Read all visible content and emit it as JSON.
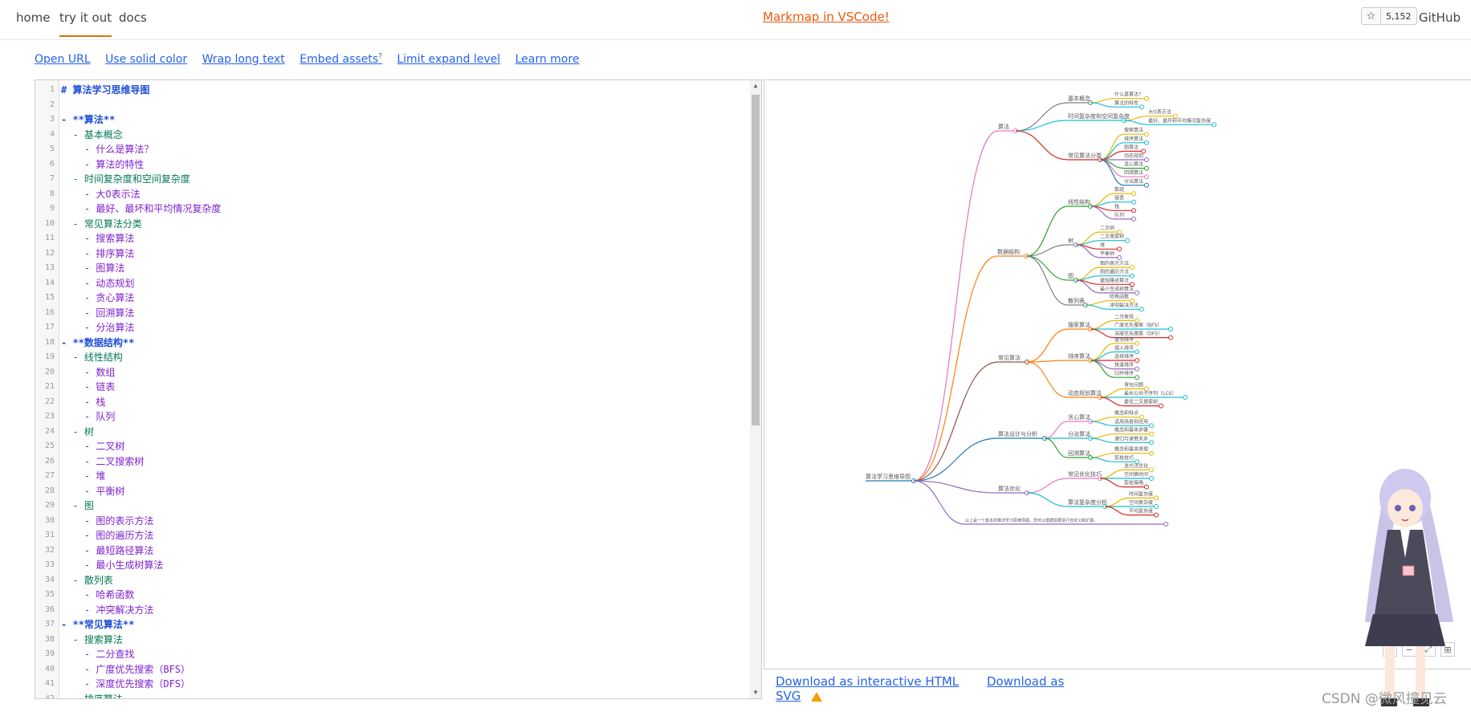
{
  "nav": {
    "home": "home",
    "try": "try it out",
    "docs": "docs",
    "banner": "Markmap in VSCode!",
    "star_count": "5,152",
    "github": "GitHub"
  },
  "toolbar": {
    "open_url": "Open URL",
    "solid_color": "Use solid color",
    "wrap": "Wrap long text",
    "embed": "Embed assets",
    "embed_sup": "?",
    "limit": "Limit expand level",
    "learn": "Learn more"
  },
  "editor": {
    "lines": [
      {
        "n": "1",
        "t": "# 算法学习思维导图",
        "c": "h1"
      },
      {
        "n": "2",
        "t": "",
        "c": "l1"
      },
      {
        "n": "3",
        "t": "- **算法**",
        "c": "l0"
      },
      {
        "n": "4",
        "t": "  - 基本概念",
        "c": "l1"
      },
      {
        "n": "5",
        "t": "    - 什么是算法？",
        "c": "l2"
      },
      {
        "n": "6",
        "t": "    - 算法的特性",
        "c": "l2"
      },
      {
        "n": "7",
        "t": "  - 时间复杂度和空间复杂度",
        "c": "l1"
      },
      {
        "n": "8",
        "t": "    - 大O表示法",
        "c": "l2"
      },
      {
        "n": "9",
        "t": "    - 最好、最坏和平均情况复杂度",
        "c": "l2"
      },
      {
        "n": "10",
        "t": "  - 常见算法分类",
        "c": "l1"
      },
      {
        "n": "11",
        "t": "    - 搜索算法",
        "c": "l2"
      },
      {
        "n": "12",
        "t": "    - 排序算法",
        "c": "l2"
      },
      {
        "n": "13",
        "t": "    - 图算法",
        "c": "l2"
      },
      {
        "n": "14",
        "t": "    - 动态规划",
        "c": "l2"
      },
      {
        "n": "15",
        "t": "    - 贪心算法",
        "c": "l2"
      },
      {
        "n": "16",
        "t": "    - 回溯算法",
        "c": "l2"
      },
      {
        "n": "17",
        "t": "    - 分治算法",
        "c": "l2"
      },
      {
        "n": "18",
        "t": "- **数据结构**",
        "c": "l0"
      },
      {
        "n": "19",
        "t": "  - 线性结构",
        "c": "l1"
      },
      {
        "n": "20",
        "t": "    - 数组",
        "c": "l2"
      },
      {
        "n": "21",
        "t": "    - 链表",
        "c": "l2"
      },
      {
        "n": "22",
        "t": "    - 栈",
        "c": "l2"
      },
      {
        "n": "23",
        "t": "    - 队列",
        "c": "l2"
      },
      {
        "n": "24",
        "t": "  - 树",
        "c": "l1"
      },
      {
        "n": "25",
        "t": "    - 二叉树",
        "c": "l2"
      },
      {
        "n": "26",
        "t": "    - 二叉搜索树",
        "c": "l2"
      },
      {
        "n": "27",
        "t": "    - 堆",
        "c": "l2"
      },
      {
        "n": "28",
        "t": "    - 平衡树",
        "c": "l2"
      },
      {
        "n": "29",
        "t": "  - 图",
        "c": "l1"
      },
      {
        "n": "30",
        "t": "    - 图的表示方法",
        "c": "l2"
      },
      {
        "n": "31",
        "t": "    - 图的遍历方法",
        "c": "l2"
      },
      {
        "n": "32",
        "t": "    - 最短路径算法",
        "c": "l2"
      },
      {
        "n": "33",
        "t": "    - 最小生成树算法",
        "c": "l2"
      },
      {
        "n": "34",
        "t": "  - 散列表",
        "c": "l1"
      },
      {
        "n": "35",
        "t": "    - 哈希函数",
        "c": "l2"
      },
      {
        "n": "36",
        "t": "    - 冲突解决方法",
        "c": "l2"
      },
      {
        "n": "37",
        "t": "- **常见算法**",
        "c": "l0"
      },
      {
        "n": "38",
        "t": "  - 搜索算法",
        "c": "l1"
      },
      {
        "n": "39",
        "t": "    - 二分查找",
        "c": "l2"
      },
      {
        "n": "40",
        "t": "    - 广度优先搜索（BFS）",
        "c": "l2"
      },
      {
        "n": "41",
        "t": "    - 深度优先搜索（DFS）",
        "c": "l2"
      },
      {
        "n": "42",
        "t": "  - 排序算法",
        "c": "l1"
      }
    ]
  },
  "mindmap": {
    "root": "算法学习思维导图",
    "branches": [
      {
        "label": "算法",
        "color": "#e377c2",
        "children": [
          {
            "label": "基本概念",
            "color": "#7f7f7f",
            "children": [
              "什么是算法?",
              "算法的特性"
            ]
          },
          {
            "label": "时间复杂度和空间复杂度",
            "color": "#17becf",
            "children": [
              "大O表示法",
              "最好、最坏和平均情况复杂度"
            ]
          },
          {
            "label": "常见算法分类",
            "color": "#d62728",
            "children": [
              "搜索算法",
              "排序算法",
              "图算法",
              "动态规划",
              "贪心算法",
              "回溯算法",
              "分治算法"
            ]
          }
        ]
      },
      {
        "label": "数据结构",
        "color": "#ff7f0e",
        "children": [
          {
            "label": "线性结构",
            "color": "#2ca02c",
            "children": [
              "数组",
              "链表",
              "栈",
              "队列"
            ]
          },
          {
            "label": "树",
            "color": "#7f7f7f",
            "children": [
              "二叉树",
              "二叉搜索树",
              "堆",
              "平衡树"
            ]
          },
          {
            "label": "图",
            "color": "#2ca02c",
            "children": [
              "图的表示方法",
              "图的遍历方法",
              "最短路径算法",
              "最小生成树算法"
            ]
          },
          {
            "label": "散列表",
            "color": "#7f7f7f",
            "children": [
              "哈希函数",
              "冲突解决方法"
            ]
          }
        ]
      },
      {
        "label": "常见算法",
        "color": "#8c564b",
        "children": [
          {
            "label": "搜索算法",
            "color": "#ff7f0e",
            "children": [
              "二分查找",
              "广度优先搜索（BFS）",
              "深度优先搜索（DFS）"
            ]
          },
          {
            "label": "排序算法",
            "color": "#ff7f0e",
            "children": [
              "冒泡排序",
              "插入排序",
              "选择排序",
              "快速排序",
              "归并排序"
            ]
          },
          {
            "label": "动态规划算法",
            "color": "#ff7f0e",
            "children": [
              "背包问题",
              "最长公共子序列（LCS）",
              "最优二叉搜索树"
            ]
          }
        ]
      },
      {
        "label": "算法设计与分析",
        "color": "#1f77b4",
        "children": [
          {
            "label": "贪心算法",
            "color": "#e377c2",
            "children": [
              "概念和特点",
              "适用场景和应用"
            ]
          },
          {
            "label": "分治算法",
            "color": "#17becf",
            "children": [
              "概念和基本步骤",
              "递归与递推关系"
            ]
          },
          {
            "label": "回溯算法",
            "color": "#2ca02c",
            "children": [
              "概念和基本原理",
              "剪枝技巧"
            ]
          }
        ]
      },
      {
        "label": "算法优化",
        "color": "#9467bd",
        "children": [
          {
            "label": "常见优化技巧",
            "color": "#e377c2",
            "children": [
              "迭代法优化",
              "空间换时间",
              "剪枝策略"
            ]
          },
          {
            "label": "算法复杂度分析",
            "color": "#17becf",
            "children": [
              "时间复杂度",
              "空间复杂度",
              "平均复杂度"
            ]
          }
        ]
      },
      {
        "label": "以上是一个基本的算法学习思维导图，您可以根据需要进行自定义和扩展。",
        "color": "#9467bd",
        "children": []
      }
    ]
  },
  "downloads": {
    "html": "Download as interactive HTML",
    "svg": "Download as SVG"
  },
  "watermark": "CSDN @微风撞见云"
}
